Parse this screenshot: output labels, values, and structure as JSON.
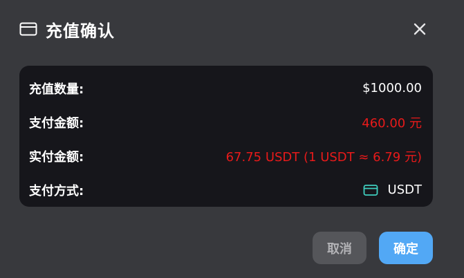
{
  "dialog": {
    "title": "充值确认",
    "title_icon": "card-icon",
    "close_icon": "close-icon"
  },
  "details": {
    "rows": [
      {
        "label": "充值数量:",
        "value": "$1000.00"
      },
      {
        "label": "支付金额:",
        "value": "460.00 元"
      },
      {
        "label": "实付金额:",
        "value": "67.75 USDT (1 USDT ≈ 6.79 元)"
      },
      {
        "label": "支付方式:",
        "value": "USDT",
        "icon": "card-icon"
      }
    ]
  },
  "actions": {
    "cancel_label": "取消",
    "confirm_label": "确定"
  },
  "colors": {
    "background": "#38393d",
    "panel": "#16161b",
    "highlight_red": "#e81a1a",
    "accent_teal": "#3fd0c0",
    "confirm_blue": "#52a8f5",
    "cancel_gray": "#55565a"
  }
}
